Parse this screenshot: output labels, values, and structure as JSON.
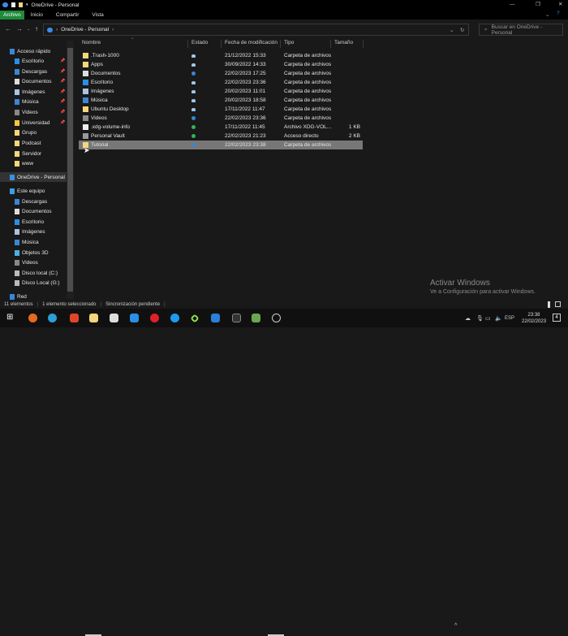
{
  "window": {
    "title": "OneDrive - Personal"
  },
  "ribbon": {
    "tabs": [
      "Archivo",
      "Inicio",
      "Compartir",
      "Vista"
    ]
  },
  "address": {
    "path": "OneDrive - Personal",
    "search_placeholder": "Buscar en OneDrive - Personal"
  },
  "sidebar": {
    "items": [
      {
        "label": "Acceso rápido",
        "icon": "star-icon",
        "pin": false
      },
      {
        "label": "Escritorio",
        "icon": "desktop-icon",
        "pin": true
      },
      {
        "label": "Descargas",
        "icon": "download-icon",
        "pin": true
      },
      {
        "label": "Documentos",
        "icon": "document-icon",
        "pin": true
      },
      {
        "label": "Imágenes",
        "icon": "pictures-icon",
        "pin": true
      },
      {
        "label": "Música",
        "icon": "music-icon",
        "pin": true
      },
      {
        "label": "Videos",
        "icon": "video-icon",
        "pin": true
      },
      {
        "label": "Universidad",
        "icon": "star-folder-icon",
        "pin": true
      },
      {
        "label": "Grupo",
        "icon": "folder-icon",
        "pin": false
      },
      {
        "label": "Podcast",
        "icon": "folder-icon",
        "pin": false
      },
      {
        "label": "Servidor",
        "icon": "folder-icon",
        "pin": false
      },
      {
        "label": "www",
        "icon": "folder-icon",
        "pin": false
      },
      {
        "label": "OneDrive - Personal",
        "icon": "cloud-icon",
        "pin": false
      },
      {
        "label": "Este equipo",
        "icon": "computer-icon",
        "pin": false
      },
      {
        "label": "Descargas",
        "icon": "download-icon",
        "pin": false
      },
      {
        "label": "Documentos",
        "icon": "document-icon",
        "pin": false
      },
      {
        "label": "Escritorio",
        "icon": "desktop-icon",
        "pin": false
      },
      {
        "label": "Imágenes",
        "icon": "pictures-icon",
        "pin": false
      },
      {
        "label": "Música",
        "icon": "music-icon",
        "pin": false
      },
      {
        "label": "Objetos 3D",
        "icon": "cube-icon",
        "pin": false
      },
      {
        "label": "Videos",
        "icon": "video-icon",
        "pin": false
      },
      {
        "label": "Disco local (C:)",
        "icon": "drive-icon",
        "pin": false
      },
      {
        "label": "Disco Local (G:)",
        "icon": "drive-icon",
        "pin": false
      },
      {
        "label": "Red",
        "icon": "network-icon",
        "pin": false
      }
    ]
  },
  "columns": [
    "Nombre",
    "Estado",
    "Fecha de modificación",
    "Tipo",
    "Tamaño"
  ],
  "files": [
    {
      "name": ".Trash-1000",
      "status": "cloud",
      "date": "21/12/2022 15:33",
      "type": "Carpeta de archivos",
      "size": "",
      "icon": "folder-icon"
    },
    {
      "name": "Apps",
      "status": "cloud",
      "date": "30/09/2022 14:33",
      "type": "Carpeta de archivos",
      "size": "",
      "icon": "folder-icon"
    },
    {
      "name": "Documentos",
      "status": "sync",
      "date": "22/02/2023 17:25",
      "type": "Carpeta de archivos",
      "size": "",
      "icon": "document-icon"
    },
    {
      "name": "Escritorio",
      "status": "cloud",
      "date": "22/02/2023 23:36",
      "type": "Carpeta de archivos",
      "size": "",
      "icon": "desktop-icon"
    },
    {
      "name": "Imágenes",
      "status": "cloud",
      "date": "20/02/2023 11:01",
      "type": "Carpeta de archivos",
      "size": "",
      "icon": "pictures-icon"
    },
    {
      "name": "Música",
      "status": "cloud",
      "date": "20/02/2023 18:58",
      "type": "Carpeta de archivos",
      "size": "",
      "icon": "music-icon"
    },
    {
      "name": "Ubuntu Desktop",
      "status": "cloud",
      "date": "17/11/2022 11:47",
      "type": "Carpeta de archivos",
      "size": "",
      "icon": "folder-icon"
    },
    {
      "name": "Videos",
      "status": "sync",
      "date": "22/02/2023 23:36",
      "type": "Carpeta de archivos",
      "size": "",
      "icon": "video-icon"
    },
    {
      "name": ".xdg-volume-info",
      "status": "ok",
      "date": "17/11/2022 11:45",
      "type": "Archivo XDG-VOL...",
      "size": "1 KB",
      "icon": "file-icon"
    },
    {
      "name": "Personal Vault",
      "status": "ok",
      "date": "22/02/2023 21:23",
      "type": "Acceso directo",
      "size": "2 KB",
      "icon": "vault-icon"
    },
    {
      "name": "Tutorial",
      "status": "sync",
      "date": "22/02/2023 23:38",
      "type": "Carpeta de archivos",
      "size": "",
      "icon": "folder-icon",
      "selected": true
    }
  ],
  "status": {
    "count": "11 elementos",
    "selected": "1 elemento seleccionado",
    "sync": "Sincronización pendiente"
  },
  "watermark": {
    "title": "Activar Windows",
    "subtitle": "Ve a Configuración para activar Windows."
  },
  "tray": {
    "lang": "ESP",
    "time": "23:38",
    "date": "22/02/2023",
    "notifications": "4"
  },
  "colors": {
    "accent": "#1e8a3a",
    "cloud": "#9ec6e8",
    "sync": "#3a86d6",
    "ok": "#2fb45a",
    "folder": "#f5d67a"
  }
}
